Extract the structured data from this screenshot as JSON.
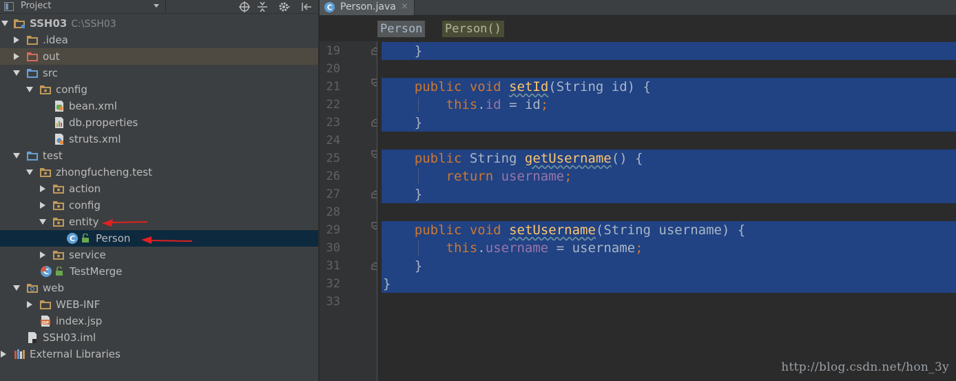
{
  "project_panel": {
    "title": "Project",
    "tree": [
      {
        "label": "SSH03",
        "sub": "C:\\SSH03",
        "bold": true,
        "expanded": true,
        "icon": "module-folder-icon"
      },
      {
        "label": ".idea",
        "expanded": false,
        "icon": "folder-icon"
      },
      {
        "label": "out",
        "expanded": false,
        "icon": "excluded-folder-icon"
      },
      {
        "label": "src",
        "expanded": true,
        "icon": "source-folder-icon"
      },
      {
        "label": "config",
        "expanded": true,
        "icon": "package-icon"
      },
      {
        "label": "bean.xml",
        "icon": "spring-xml-icon"
      },
      {
        "label": "db.properties",
        "icon": "properties-file-icon"
      },
      {
        "label": "struts.xml",
        "icon": "struts-xml-icon"
      },
      {
        "label": "test",
        "expanded": true,
        "icon": "source-folder-icon"
      },
      {
        "label": "zhongfucheng.test",
        "expanded": true,
        "icon": "package-icon"
      },
      {
        "label": "action",
        "expanded": false,
        "icon": "package-icon"
      },
      {
        "label": "config",
        "expanded": false,
        "icon": "package-icon"
      },
      {
        "label": "entity",
        "expanded": true,
        "icon": "package-icon"
      },
      {
        "label": "Person",
        "icon": "java-class-icon",
        "selected": true
      },
      {
        "label": "service",
        "expanded": false,
        "icon": "package-icon"
      },
      {
        "label": "TestMerge",
        "icon": "java-test-class-icon"
      },
      {
        "label": "web",
        "expanded": true,
        "icon": "web-folder-icon"
      },
      {
        "label": "WEB-INF",
        "expanded": false,
        "icon": "folder-icon"
      },
      {
        "label": "index.jsp",
        "icon": "jsp-file-icon"
      },
      {
        "label": "SSH03.iml",
        "icon": "iml-file-icon"
      },
      {
        "label": "External Libraries",
        "expanded": false,
        "icon": "libraries-icon"
      }
    ]
  },
  "editor": {
    "tab_label": "Person.java",
    "tab_close": "×",
    "breadcrumb": {
      "class": "Person",
      "method": "Person()"
    },
    "line_numbers": [
      "19",
      "20",
      "21",
      "22",
      "23",
      "24",
      "25",
      "26",
      "27",
      "28",
      "29",
      "30",
      "31",
      "32",
      "33"
    ],
    "code_lines": [
      [
        {
          "t": "    }"
        }
      ],
      [],
      [
        {
          "t": "    "
        },
        {
          "t": "public",
          "c": "kw"
        },
        {
          "t": " "
        },
        {
          "t": "void",
          "c": "kw"
        },
        {
          "t": " "
        },
        {
          "t": "setId",
          "c": "fn"
        },
        {
          "t": "(String id) {"
        }
      ],
      [
        {
          "t": "        "
        },
        {
          "t": "this",
          "c": "kw"
        },
        {
          "t": "."
        },
        {
          "t": "id",
          "c": "fld"
        },
        {
          "t": " = id"
        },
        {
          "t": ";",
          "c": "kw"
        }
      ],
      [
        {
          "t": "    }"
        }
      ],
      [],
      [
        {
          "t": "    "
        },
        {
          "t": "public",
          "c": "kw"
        },
        {
          "t": " String "
        },
        {
          "t": "getUsername",
          "c": "fn"
        },
        {
          "t": "() {"
        }
      ],
      [
        {
          "t": "        "
        },
        {
          "t": "return",
          "c": "kw"
        },
        {
          "t": " "
        },
        {
          "t": "username",
          "c": "fld"
        },
        {
          "t": ";",
          "c": "kw"
        }
      ],
      [
        {
          "t": "    }"
        }
      ],
      [],
      [
        {
          "t": "    "
        },
        {
          "t": "public",
          "c": "kw"
        },
        {
          "t": " "
        },
        {
          "t": "void",
          "c": "kw"
        },
        {
          "t": " "
        },
        {
          "t": "setUsername",
          "c": "fn"
        },
        {
          "t": "(String username) {"
        }
      ],
      [
        {
          "t": "        "
        },
        {
          "t": "this",
          "c": "kw"
        },
        {
          "t": "."
        },
        {
          "t": "username",
          "c": "fld"
        },
        {
          "t": " = username"
        },
        {
          "t": ";",
          "c": "kw"
        }
      ],
      [
        {
          "t": "    }"
        }
      ],
      [
        {
          "t": "}"
        }
      ],
      []
    ]
  },
  "watermark": "http://blog.csdn.net/hon_3y",
  "colors": {
    "selection": "#214283",
    "keyword": "#cc7832",
    "field": "#9876aa",
    "annotation_arrow": "#e02020"
  }
}
